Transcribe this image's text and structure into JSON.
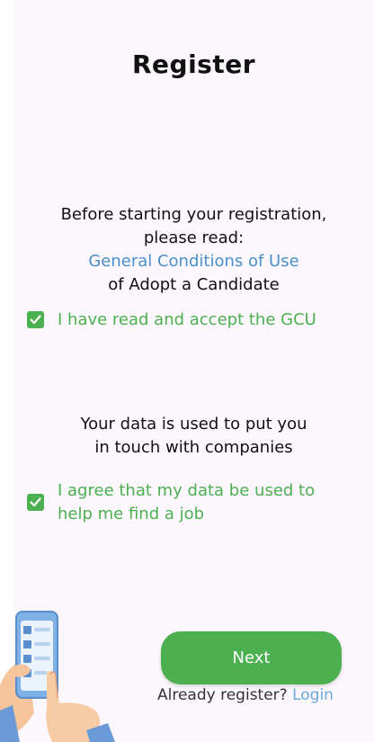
{
  "page": {
    "title": "Register"
  },
  "gcu_section": {
    "line1": "Before starting your registration,",
    "line2": "please read:",
    "link": "General Conditions of Use",
    "line4": "of Adopt a Candidate",
    "checkbox_label": "I have read and accept the GCU",
    "checked": true
  },
  "data_section": {
    "line1": "Your data is used to put you",
    "line2": "in touch with companies",
    "checkbox_label_line1": "I agree that my data be used to",
    "checkbox_label_line2": "help me find a job",
    "checked": true
  },
  "actions": {
    "next_label": "Next",
    "already_text": "Already register?",
    "login_label": "Login"
  },
  "colors": {
    "accent_green": "#4caf50",
    "link_blue": "#4a90c8",
    "background": "#fbf7fd"
  },
  "illustration": {
    "icon": "hand-holding-phone-checklist-illustration"
  }
}
